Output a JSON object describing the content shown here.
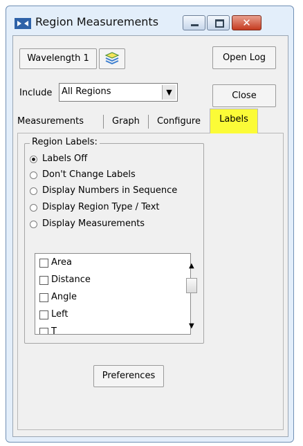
{
  "window": {
    "title": "Region Measurements"
  },
  "titlebar_buttons": {
    "minimize": "–",
    "maximize": "□",
    "close": "✕"
  },
  "toolbar": {
    "wavelength_label": "Wavelength 1",
    "stack_icon": "stack-layers-icon",
    "open_log_label": "Open Log",
    "close_label": "Close"
  },
  "include": {
    "label": "Include",
    "selected": "All Regions",
    "arrow": "▼"
  },
  "tabs": [
    {
      "label": "Measurements",
      "active": false
    },
    {
      "label": "Graph",
      "active": false
    },
    {
      "label": "Configure",
      "active": false
    },
    {
      "label": "Labels",
      "active": true
    }
  ],
  "region_labels": {
    "title": "Region Labels:",
    "options": [
      {
        "label": "Labels Off",
        "checked": true
      },
      {
        "label": "Don't Change Labels",
        "checked": false
      },
      {
        "label": "Display Numbers in Sequence",
        "checked": false
      },
      {
        "label": "Display Region Type / Text",
        "checked": false
      },
      {
        "label": "Display Measurements",
        "checked": false
      }
    ]
  },
  "measurements_list": {
    "items": [
      {
        "label": "Area",
        "checked": false
      },
      {
        "label": "Distance",
        "checked": false
      },
      {
        "label": "Angle",
        "checked": false
      },
      {
        "label": "Left",
        "checked": false
      },
      {
        "label": "T",
        "checked": false
      }
    ],
    "scroll_up": "▲",
    "scroll_down": "▼"
  },
  "preferences_label": "Preferences",
  "colors": {
    "active_tab_highlight": "#fbfb37",
    "window_frame": "#e3eefa",
    "close_button": "#c53a1f"
  }
}
